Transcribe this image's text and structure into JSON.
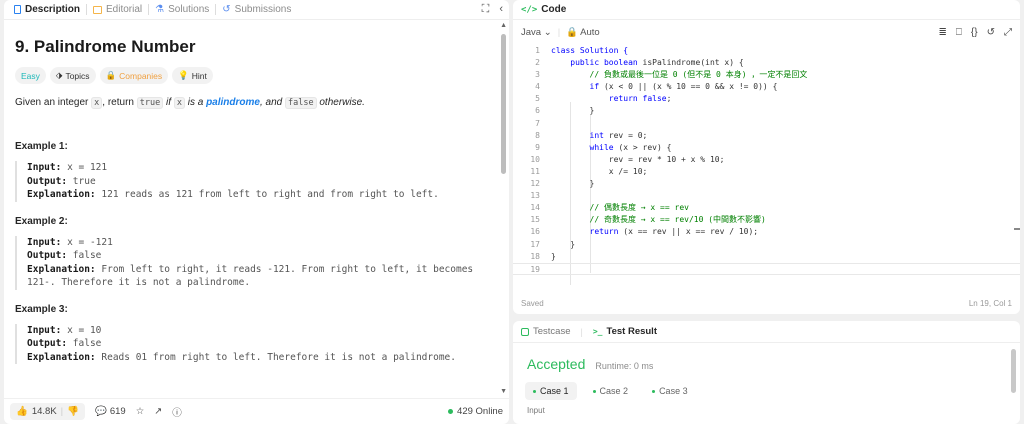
{
  "left_tabs": {
    "description": "Description",
    "editorial": "Editorial",
    "solutions": "Solutions",
    "submissions": "Submissions"
  },
  "problem": {
    "title": "9. Palindrome Number",
    "tags": {
      "easy": "Easy",
      "topics": "Topics",
      "companies": "Companies",
      "hint": "Hint"
    },
    "desc": {
      "p1": "Given an integer ",
      "x": "x",
      "p2": ", return ",
      "true": "true",
      "p3": " if ",
      "p4": " is a ",
      "palindrome": "palindrome",
      "p5": ", and ",
      "false": "false",
      "p6": " otherwise."
    },
    "examples": [
      {
        "heading": "Example 1:",
        "input_label": "Input:",
        "input": "x = 121",
        "output_label": "Output:",
        "output": "true",
        "expl_label": "Explanation:",
        "expl": "121 reads as 121 from left to right and from right to left."
      },
      {
        "heading": "Example 2:",
        "input_label": "Input:",
        "input": "x = -121",
        "output_label": "Output:",
        "output": "false",
        "expl_label": "Explanation:",
        "expl": "From left to right, it reads -121. From right to left, it becomes",
        "expl2": "121-. Therefore it is not a palindrome."
      },
      {
        "heading": "Example 3:",
        "input_label": "Input:",
        "input": "x = 10",
        "output_label": "Output:",
        "output": "false",
        "expl_label": "Explanation:",
        "expl": "Reads 01 from right to left. Therefore it is not a palindrome."
      }
    ]
  },
  "footer": {
    "likes": "14.8K",
    "comments": "619",
    "online": "429 Online"
  },
  "code_panel": {
    "title": "Code",
    "language": "Java",
    "mode": "Auto",
    "status": "Saved",
    "position": "Ln 19, Col 1"
  },
  "code_lines": [
    "1",
    "2",
    "3",
    "4",
    "5",
    "6",
    "7",
    "8",
    "9",
    "10",
    "11",
    "12",
    "13",
    "14",
    "15",
    "16",
    "17",
    "18",
    "19"
  ],
  "code": {
    "l1": "class Solution {",
    "l2_kw": "public boolean",
    "l2": " isPalindrome(int x) {",
    "l3": "// 負數或最後一位是 0 (但不是 0 本身) ，一定不是回文",
    "l4_kw": "if",
    "l4": " (x < 0 || (x % 10 == 0 && x != 0)) {",
    "l5_kw": "return false",
    "l5": ";",
    "l6": "}",
    "l8_kw": "int",
    "l8": " rev = 0;",
    "l9_kw": "while",
    "l9": " (x > rev) {",
    "l10": "rev = rev * 10 + x % 10;",
    "l11": "x /= 10;",
    "l12": "}",
    "l14": "// 偶數長度 → x == rev",
    "l15": "// 奇數長度 → x == rev/10 (中間數不影響)",
    "l16_kw": "return",
    "l16": " (x == rev || x == rev / 10);",
    "l17": "}",
    "l18": "}"
  },
  "result_panel": {
    "tab_testcase": "Testcase",
    "tab_result": "Test Result",
    "status": "Accepted",
    "runtime": "Runtime: 0 ms",
    "cases": [
      "Case 1",
      "Case 2",
      "Case 3"
    ],
    "input_label": "Input"
  },
  "colors": {
    "accent_green": "#2cbb5d",
    "link_blue": "#1a7fe8",
    "easy_teal": "#1cb8b8",
    "companies_orange": "#f0a040"
  }
}
